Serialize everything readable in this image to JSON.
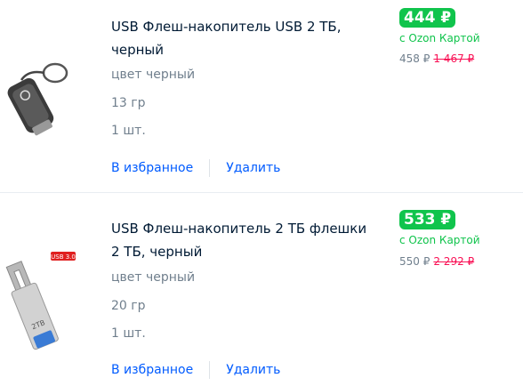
{
  "items": [
    {
      "title": "USB Флеш-накопитель USB 2 ТБ, черный",
      "color": "цвет черный",
      "weight": "13 гр",
      "quantity": "1 шт.",
      "price": "444 ₽",
      "ozon_card_label": "с Ozon Картой",
      "price_without_card": "458 ₽",
      "old_price": "1 467 ₽",
      "favorite_label": "В избранное",
      "delete_label": "Удалить"
    },
    {
      "title": "USB Флеш-накопитель 2 ТБ флешки 2 ТБ, черный",
      "color": "цвет черный",
      "weight": "20 гр",
      "quantity": "1 шт.",
      "price": "533 ₽",
      "ozon_card_label": "с Ozon Картой",
      "price_without_card": "550 ₽",
      "old_price": "2 292 ₽",
      "favorite_label": "В избранное",
      "delete_label": "Удалить",
      "image_badge": "USB 3.0",
      "image_capacity": "2TB"
    }
  ],
  "colors": {
    "accent_link": "#005bff",
    "price_green": "#10c44c",
    "strike_red": "#f91155",
    "muted": "#707f8d"
  }
}
